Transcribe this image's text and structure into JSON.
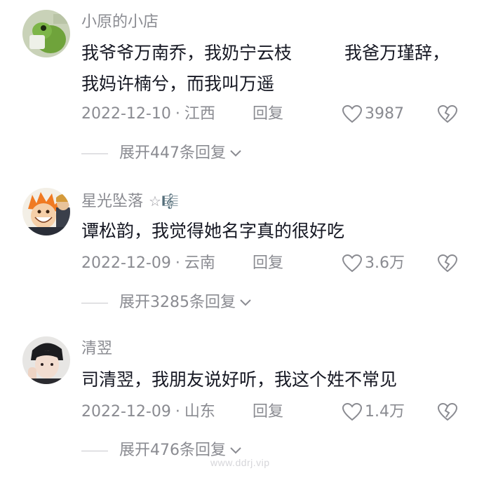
{
  "comments": [
    {
      "username": "小原的小店",
      "badge": "",
      "content": "我爷爷万南乔，我奶宁云枝　　　我爸万瑾辞，我妈许楠兮，而我叫万遥",
      "date": "2022-12-10",
      "location": "江西",
      "reply_label": "回复",
      "likes": "3987",
      "expand_label": "展开447条回复"
    },
    {
      "username": "星光坠落",
      "badge": "☆🎼",
      "content": "谭松韵，我觉得她名字真的很好吃",
      "date": "2022-12-09",
      "location": "云南",
      "reply_label": "回复",
      "likes": "3.6万",
      "expand_label": "展开3285条回复"
    },
    {
      "username": "清翌",
      "badge": "",
      "content": "司清翌，我朋友说好听，我这个姓不常见",
      "date": "2022-12-09",
      "location": "山东",
      "reply_label": "回复",
      "likes": "1.4万",
      "expand_label": "展开476条回复"
    }
  ],
  "separator": "·",
  "watermark": "www.ddrj.vip",
  "colors": {
    "text": "#161823",
    "secondary": "#8a8b91",
    "background": "#ffffff"
  },
  "icons": {
    "like": "heart-outline-icon",
    "dislike": "broken-heart-icon",
    "expand": "chevron-down-icon"
  }
}
